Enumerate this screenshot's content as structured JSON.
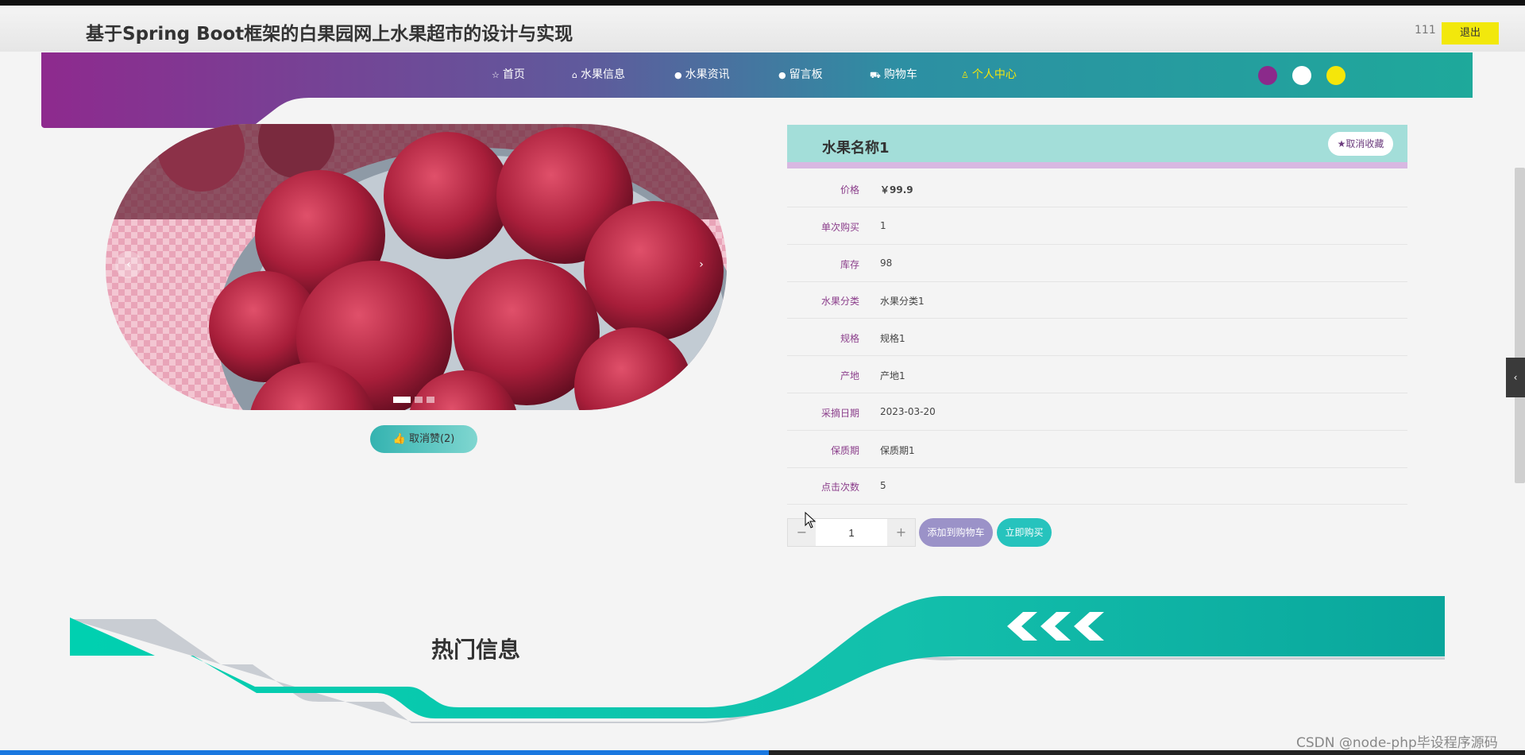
{
  "header": {
    "site_title": "基于Spring Boot框架的白果园网上水果超市的设计与实现",
    "user_name": "111",
    "logout_label": "退出"
  },
  "nav": {
    "items": [
      {
        "icon": "star-icon",
        "label": "首页"
      },
      {
        "icon": "bag-icon",
        "label": "水果信息"
      },
      {
        "icon": "info-icon",
        "label": "水果资讯"
      },
      {
        "icon": "question-icon",
        "label": "留言板"
      },
      {
        "icon": "cart-icon",
        "label": "购物车"
      },
      {
        "icon": "user-icon",
        "label": "个人中心"
      }
    ],
    "active_index": 5,
    "theme_colors": [
      "#8b2a8b",
      "#ffffff",
      "#f5e60a"
    ]
  },
  "carousel": {
    "prev_label": "‹",
    "next_label": "›",
    "slide_count": 3,
    "active_slide": 0
  },
  "like_button": {
    "label": "取消赞(2)"
  },
  "product": {
    "name": "水果名称1",
    "fav_label": "取消收藏",
    "fields": [
      {
        "label": "价格",
        "value": "￥99.9"
      },
      {
        "label": "单次购买",
        "value": "1"
      },
      {
        "label": "库存",
        "value": "98"
      },
      {
        "label": "水果分类",
        "value": "水果分类1"
      },
      {
        "label": "规格",
        "value": "规格1"
      },
      {
        "label": "产地",
        "value": "产地1"
      },
      {
        "label": "采摘日期",
        "value": "2023-03-20"
      },
      {
        "label": "保质期",
        "value": "保质期1"
      },
      {
        "label": "点击次数",
        "value": "5"
      }
    ]
  },
  "purchase": {
    "quantity": "1",
    "minus_label": "−",
    "plus_label": "+",
    "add_to_cart_label": "添加到购物车",
    "buy_now_label": "立即购买"
  },
  "hot_section": {
    "title": "热门信息"
  },
  "side_toggle_label": "‹",
  "watermark": "CSDN @node-php毕设程序源码",
  "colors": {
    "nav_gradient_start": "#8e2a8e",
    "nav_gradient_end": "#1ea99b",
    "accent_teal": "#26c3bd",
    "accent_purple": "#9b92c8",
    "label_purple": "#8b3e8b"
  }
}
